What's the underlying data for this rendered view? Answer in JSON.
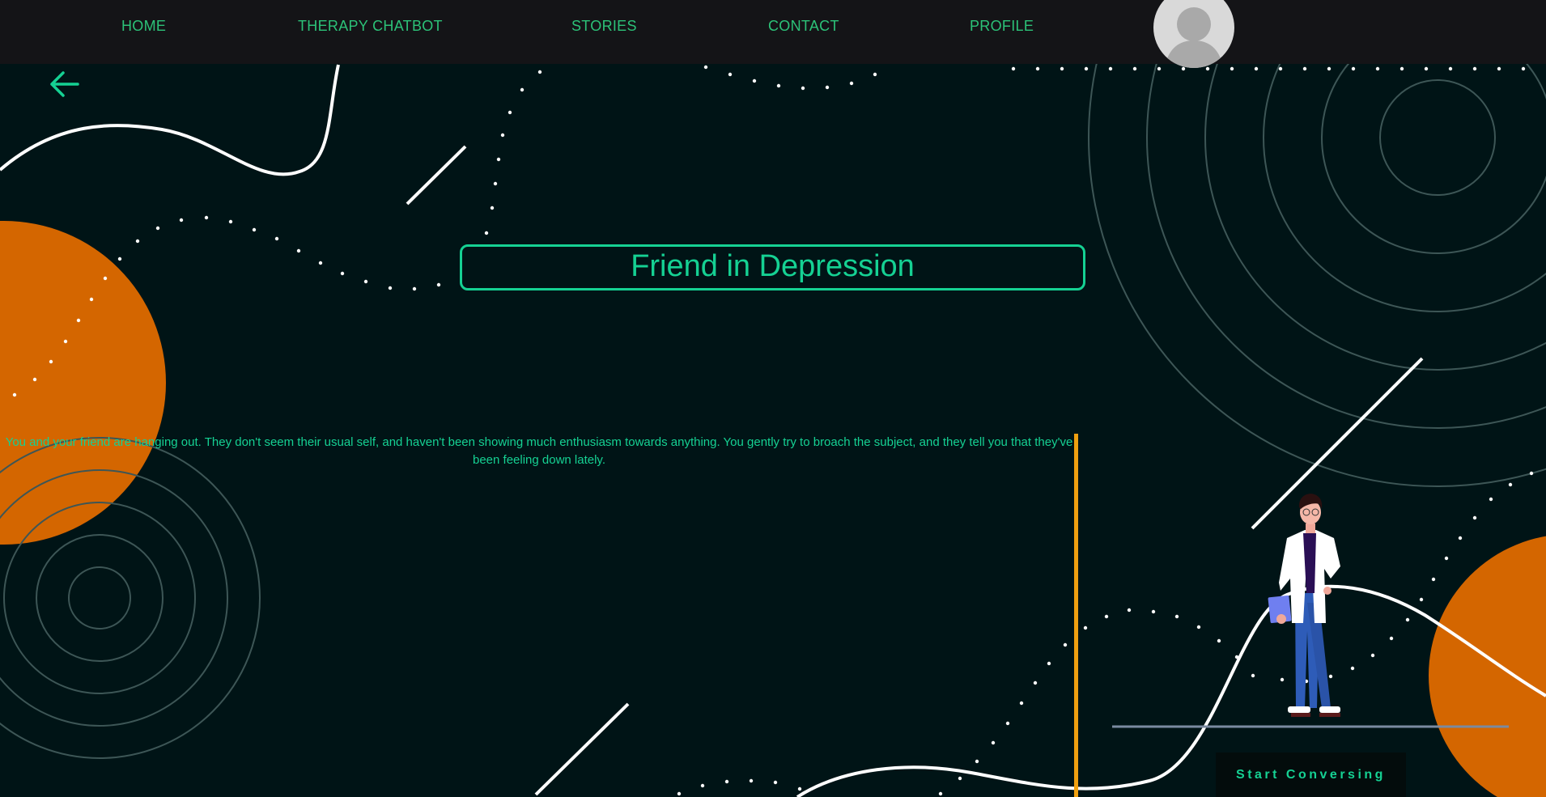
{
  "nav": {
    "items": [
      {
        "label": "HOME"
      },
      {
        "label": "THERAPY CHATBOT"
      },
      {
        "label": "STORIES"
      },
      {
        "label": "CONTACT"
      },
      {
        "label": "PROFILE"
      }
    ],
    "avatar_icon": "user-silhouette-icon"
  },
  "back_icon": "arrow-left-icon",
  "story": {
    "title": "Friend in Depression",
    "text": "You and your friend are hanging out. They don't seem their usual self, and haven't been showing much enthusiasm towards anything. You gently try to broach the subject, and they tell you that they've been feeling down lately."
  },
  "cta": {
    "label": "Start Conversing"
  },
  "colors": {
    "background": "#001416",
    "nav_background": "#141417",
    "accent_green": "#15d193",
    "orange": "#d46600",
    "divider": "#f0a010"
  }
}
